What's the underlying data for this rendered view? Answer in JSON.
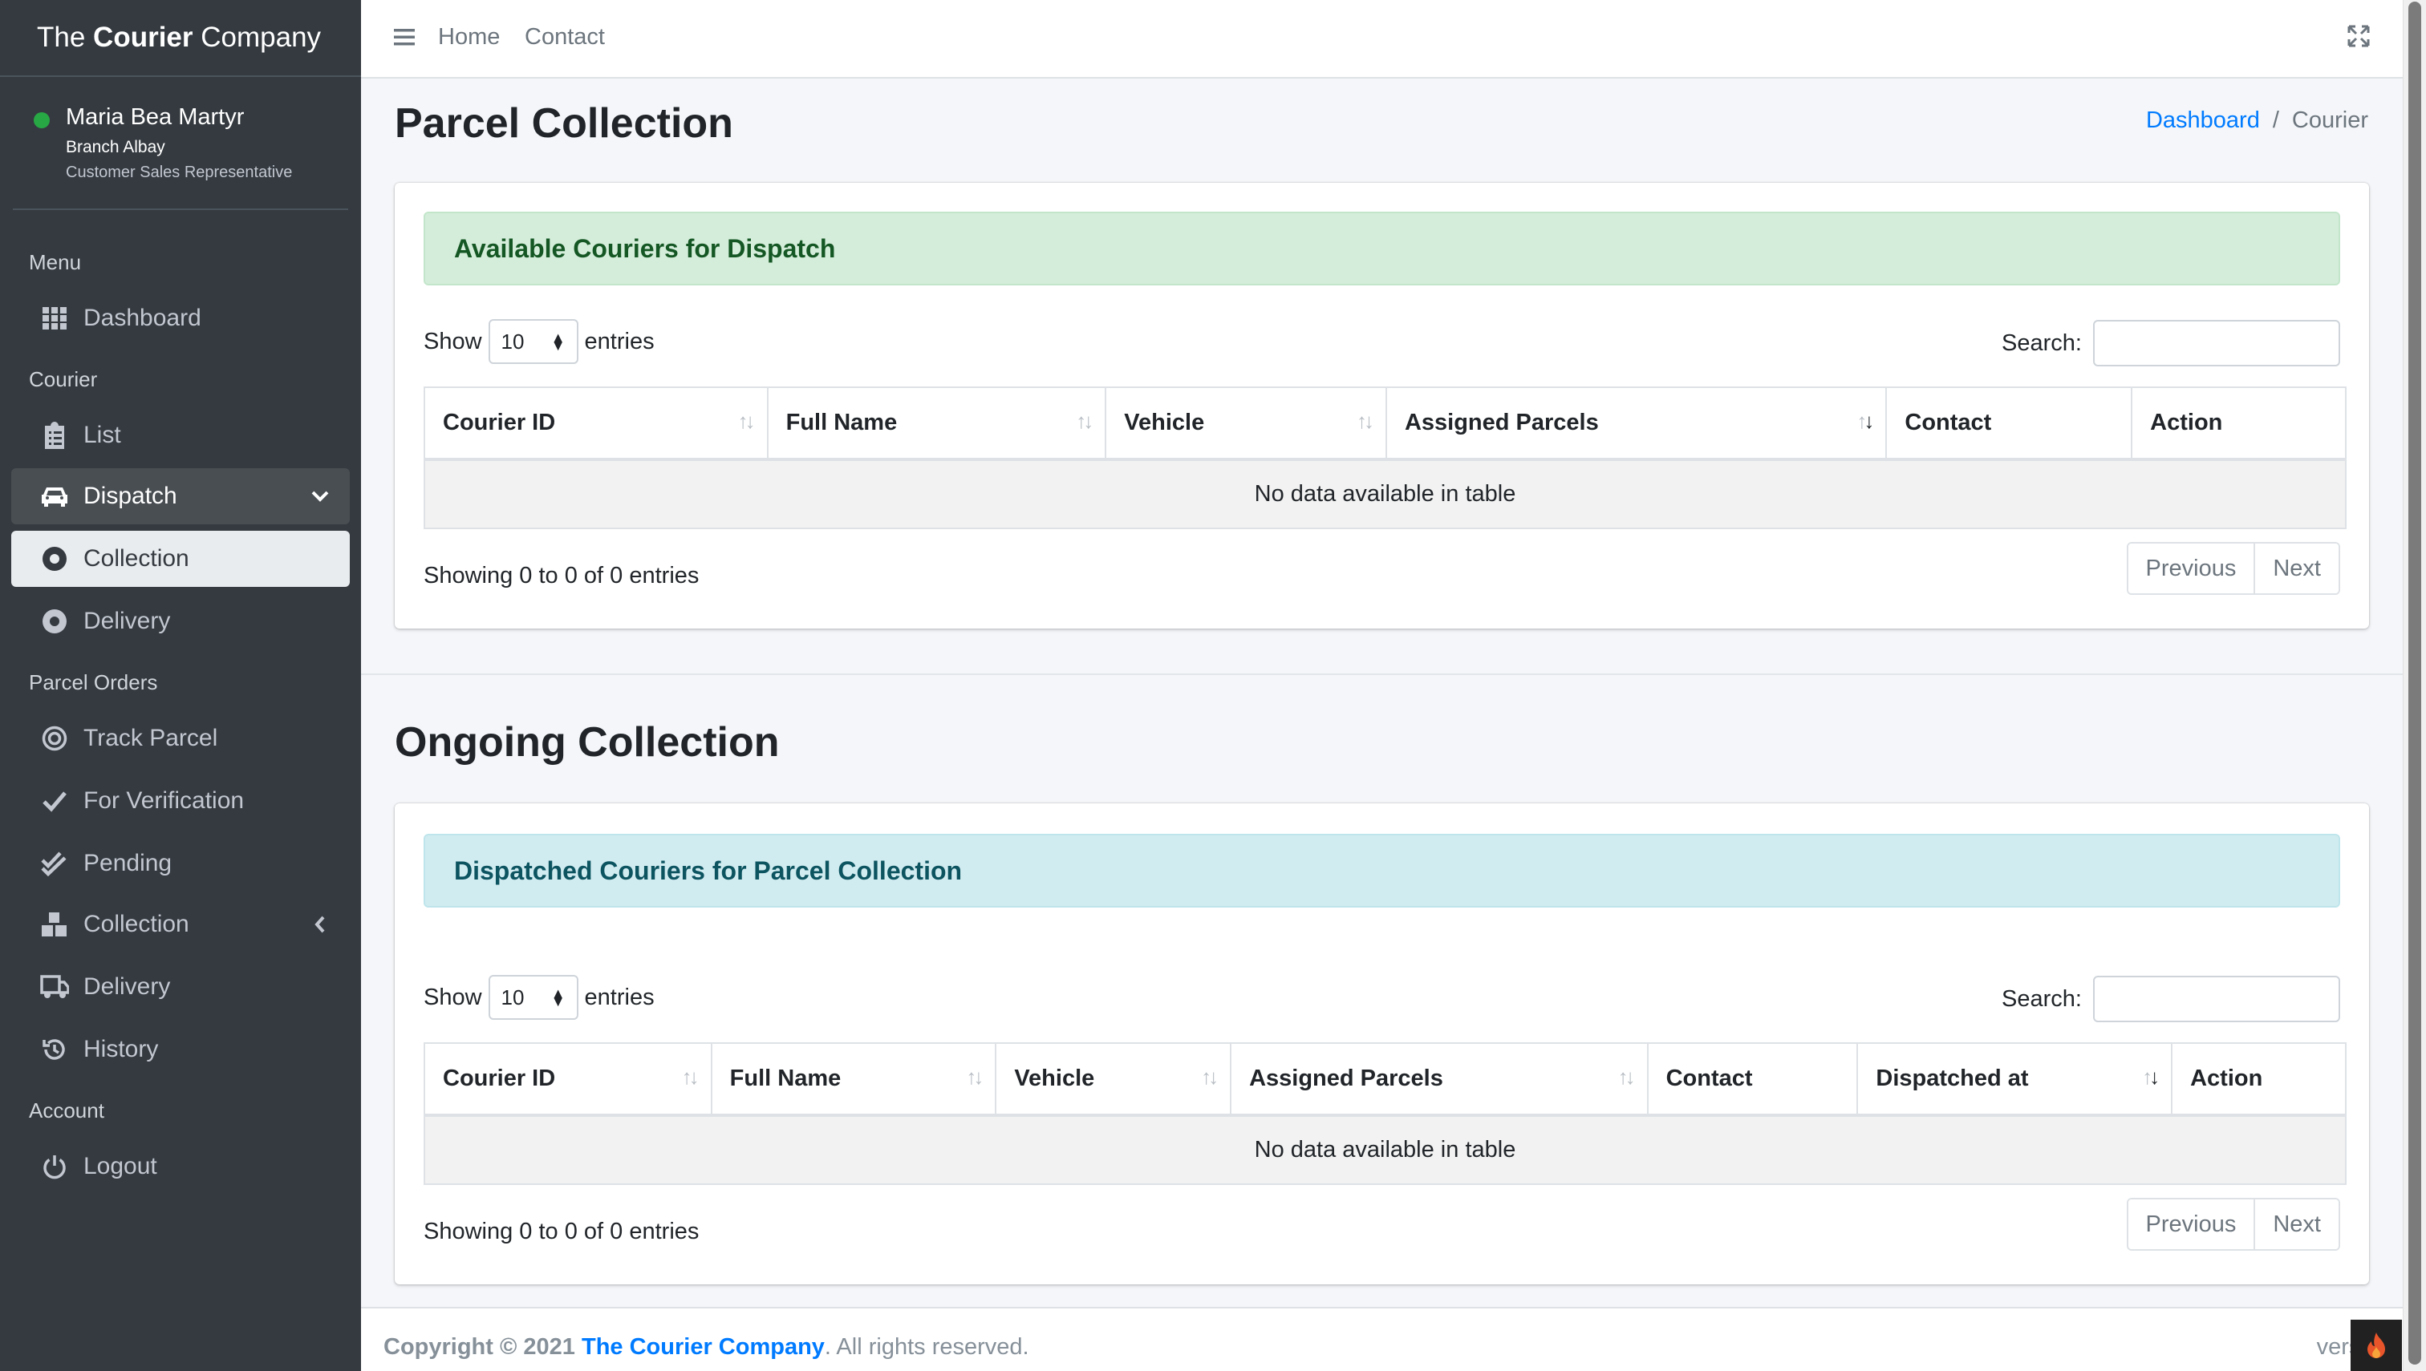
{
  "brand": {
    "prefix": "The ",
    "bold": "Courier",
    "suffix": " Company"
  },
  "user": {
    "name": "Maria Bea Martyr",
    "branch": "Branch Albay",
    "role": "Customer Sales Representative",
    "status_color": "#28a745"
  },
  "nav": {
    "header_menu": "Menu",
    "dashboard": "Dashboard",
    "header_courier": "Courier",
    "list": "List",
    "dispatch": "Dispatch",
    "collection": "Collection",
    "delivery": "Delivery",
    "header_parcel_orders": "Parcel Orders",
    "track_parcel": "Track Parcel",
    "for_verification": "For Verification",
    "pending": "Pending",
    "orders_collection": "Collection",
    "orders_delivery": "Delivery",
    "history": "History",
    "header_account": "Account",
    "logout": "Logout"
  },
  "topbar": {
    "home": "Home",
    "contact": "Contact"
  },
  "page": {
    "title": "Parcel Collection",
    "section2_title": "Ongoing Collection"
  },
  "breadcrumb": {
    "dashboard": "Dashboard",
    "separator": "/",
    "current": "Courier"
  },
  "available": {
    "alert": "Available Couriers for Dispatch",
    "show_label": "Show",
    "entries_value": "10",
    "entries_label": "entries",
    "search_label": "Search:",
    "columns": [
      "Courier ID",
      "Full Name",
      "Vehicle",
      "Assigned Parcels",
      "Contact",
      "Action"
    ],
    "empty": "No data available in table",
    "info": "Showing 0 to 0 of 0 entries",
    "prev": "Previous",
    "next": "Next"
  },
  "dispatched": {
    "alert": "Dispatched Couriers for Parcel Collection",
    "show_label": "Show",
    "entries_value": "10",
    "entries_label": "entries",
    "search_label": "Search:",
    "columns": [
      "Courier ID",
      "Full Name",
      "Vehicle",
      "Assigned Parcels",
      "Contact",
      "Dispatched at",
      "Action"
    ],
    "empty": "No data available in table",
    "info": "Showing 0 to 0 of 0 entries",
    "prev": "Previous",
    "next": "Next"
  },
  "footer": {
    "copyright": "Copyright © 2021 ",
    "company": "The Courier Company",
    "rights": ". All rights reserved.",
    "version": "versio"
  },
  "colors": {
    "accent": "#007bff",
    "sidebar_bg": "#343a40",
    "success_bg": "#d4edda",
    "info_bg": "#d1ecf1"
  }
}
